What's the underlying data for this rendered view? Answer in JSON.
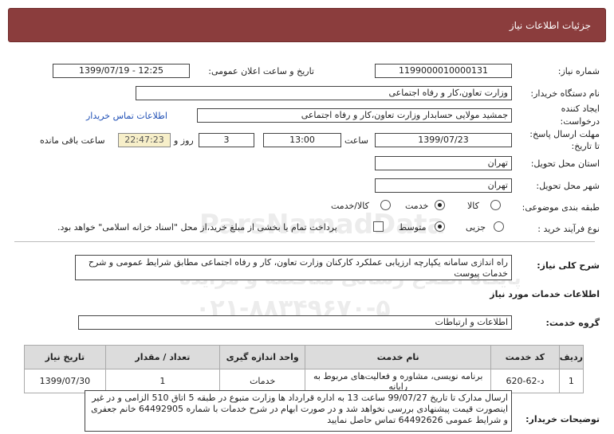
{
  "header": {
    "title": "جزئیات اطلاعات نیاز"
  },
  "form": {
    "need_number_label": "شماره نیاز:",
    "need_number": "1199000010000131",
    "announce_label": "تاریخ و ساعت اعلان عمومی:",
    "announce_value": "1399/07/19 - 12:25",
    "buyer_label": "نام دستگاه خریدار:",
    "buyer_value": "وزارت تعاون،کار و رفاه اجتماعی",
    "creator_label_1": "ایجاد کننده",
    "creator_label_2": "درخواست:",
    "creator_value": "جمشید مولایی حسابدار وزارت تعاون،کار و رفاه اجتماعی",
    "contact_link": "اطلاعات تماس خریدار",
    "deadline_label_1": "مهلت ارسال پاسخ:",
    "deadline_label_2": "تا تاریخ:",
    "deadline_date": "1399/07/23",
    "time_label": "ساعت",
    "deadline_time": "13:00",
    "days_value": "3",
    "days_label": "روز و",
    "remaining_value": "22:47:23",
    "remaining_label": "ساعت باقی مانده",
    "province_label": "استان محل تحویل:",
    "province_value": "تهران",
    "city_label": "شهر محل تحویل:",
    "city_value": "تهران",
    "category_label": "طبقه بندی موضوعی:",
    "category_options": [
      "کالا",
      "خدمت",
      "کالا/خدمت"
    ],
    "category_selected": "خدمت",
    "process_label": "نوع فرآیند خرید :",
    "process_options": [
      "جزیی",
      "متوسط"
    ],
    "process_selected": "متوسط",
    "payment_note": "پرداخت تمام یا بخشی از مبلغ خرید،از محل \"اسناد خزانه اسلامی\" خواهد بود."
  },
  "summary": {
    "label": "شرح کلی نیاز:",
    "text": "راه اندازی سامانه یکپارچه ارزیابی عملکرد کارکنان وزارت تعاون، کار و رفاه اجتماعی مطابق شرایط عمومی و شرح خدمات پیوست"
  },
  "services_section": {
    "title": "اطلاعات خدمات مورد نیاز",
    "group_label": "گروه خدمت:",
    "group_value": "اطلاعات و ارتباطات"
  },
  "table": {
    "headers": [
      "ردیف",
      "کد خدمت",
      "نام خدمت",
      "واحد اندازه گیری",
      "تعداد / مقدار",
      "تاریخ نیاز"
    ],
    "rows": [
      [
        "1",
        "د-62-620",
        "برنامه نویسی، مشاوره و فعالیت‌های مربوط به رایانه",
        "خدمات",
        "1",
        "1399/07/30"
      ]
    ]
  },
  "buyer_notes": {
    "label": "توضیحات خریدار:",
    "text": "ارسال مدارک تا تاریخ 99/07/27 ساعت 13 به اداره قرارداد ها وزارت متبوع در طبقه 5 اتاق 510 الزامی و در غیر اینصورت قیمت پیشنهادی بررسی نخواهد شد و در صورت ابهام در شرح خدمات با شماره 64492905 خانم جعفری و شرایط عمومی 64492626 تماس حاصل نمایید"
  },
  "watermark": {
    "brand": "ParsNamadData",
    "line1": "پایگاه اطلاع رسانی مناقصه و مزایده",
    "line2": "۰۲۱-۸۸۳۴۹۶۷۰-۵"
  }
}
